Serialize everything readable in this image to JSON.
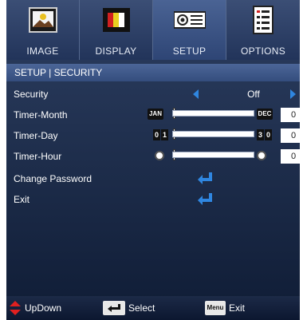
{
  "tabs": [
    {
      "label": "IMAGE",
      "icon": "image-icon"
    },
    {
      "label": "DISPLAY",
      "icon": "display-icon"
    },
    {
      "label": "SETUP",
      "icon": "projector-icon",
      "active": true
    },
    {
      "label": "OPTIONS",
      "icon": "options-icon"
    }
  ],
  "section_title": "SETUP | SECURITY",
  "rows": {
    "security": {
      "label": "Security",
      "value": "Off"
    },
    "timer_month": {
      "label": "Timer-Month",
      "min_label": "JAN",
      "max_label": "DEC",
      "value": "0"
    },
    "timer_day": {
      "label": "Timer-Day",
      "min_digits": [
        "0",
        "1"
      ],
      "max_digits": [
        "3",
        "0"
      ],
      "value": "0"
    },
    "timer_hour": {
      "label": "Timer-Hour",
      "value": "0"
    },
    "change_password": {
      "label": "Change Password"
    },
    "exit": {
      "label": "Exit"
    }
  },
  "footer": {
    "updown": "UpDown",
    "select": "Select",
    "menu_key": "Menu",
    "exit": "Exit"
  },
  "colors": {
    "accent_arrow": "#2f86e0",
    "background_top": "#2d3f62",
    "background_bottom": "#0f1c35",
    "updown_red": "#e02020"
  }
}
